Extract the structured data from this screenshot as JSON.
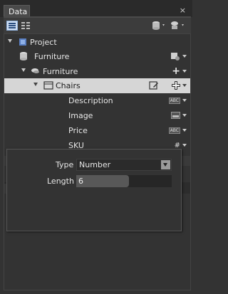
{
  "panel": {
    "title": "Data",
    "close_glyph": "×"
  },
  "tree": {
    "project": {
      "label": "Project",
      "icon": "project-icon"
    },
    "datasource": {
      "label": "Furniture",
      "icon": "database-icon"
    },
    "collection": {
      "label": "Furniture",
      "icon": "collection-icon",
      "add_glyph": "+"
    },
    "selected_item": {
      "label": "Chairs",
      "icon": "table-icon"
    },
    "fields": [
      {
        "label": "Description",
        "type_icon": "text-type-icon",
        "badge": "ABC"
      },
      {
        "label": "Image",
        "type_icon": "image-type-icon",
        "badge": ""
      },
      {
        "label": "Price",
        "type_icon": "text-type-icon",
        "badge": "ABC"
      },
      {
        "label": "SKU",
        "type_icon": "number-type-icon",
        "badge": "#"
      }
    ]
  },
  "popup": {
    "type_label": "Type",
    "type_value": "Number",
    "length_label": "Length",
    "length_value": "6"
  },
  "colors": {
    "background": "#333333",
    "selected_row": "#d6d6d6",
    "accent_blue": "#cfdff4"
  }
}
